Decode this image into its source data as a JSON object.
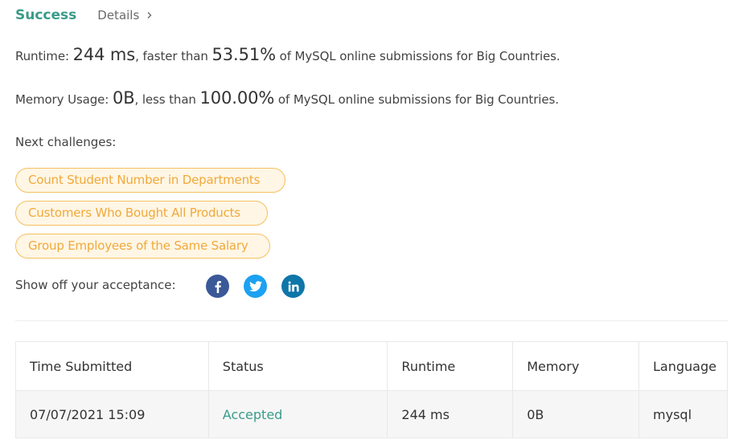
{
  "header": {
    "status": "Success",
    "details_label": "Details"
  },
  "runtime": {
    "prefix": "Runtime: ",
    "value": "244 ms",
    "middle": ", faster than ",
    "percent": "53.51%",
    "suffix": " of MySQL online submissions for Big Countries."
  },
  "memory": {
    "prefix": "Memory Usage: ",
    "value": "0B",
    "middle": ", less than ",
    "percent": "100.00%",
    "suffix": " of MySQL online submissions for Big Countries."
  },
  "next_challenges": {
    "label": "Next challenges:",
    "items": [
      "Count Student Number in Departments",
      "Customers Who Bought All Products",
      "Group Employees of the Same Salary"
    ]
  },
  "share": {
    "label": "Show off your acceptance:",
    "icons": [
      "facebook-icon",
      "twitter-icon",
      "linkedin-icon"
    ]
  },
  "table": {
    "headers": [
      "Time Submitted",
      "Status",
      "Runtime",
      "Memory",
      "Language"
    ],
    "rows": [
      [
        "07/07/2021 15:09",
        "Accepted",
        "244 ms",
        "0B",
        "mysql"
      ]
    ]
  },
  "colors": {
    "success": "#3a9b8a",
    "pill_text": "#f0a93a",
    "pill_border": "#f3c05f",
    "facebook": "#3b5998",
    "twitter": "#1da1f2",
    "linkedin": "#0e76a8"
  }
}
